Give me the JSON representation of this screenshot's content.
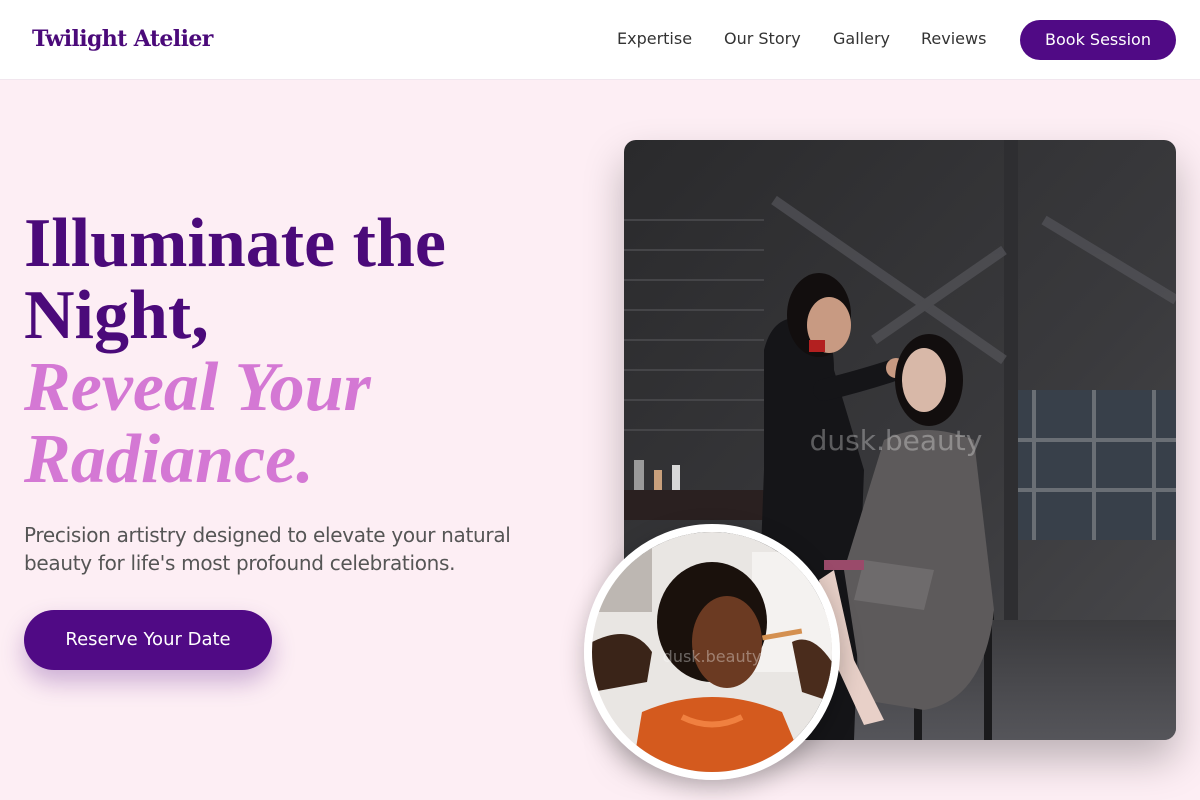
{
  "header": {
    "logo": "Twilight Atelier",
    "nav": {
      "expertise": "Expertise",
      "story": "Our Story",
      "gallery": "Gallery",
      "reviews": "Reviews"
    },
    "cta_label": "Book Session"
  },
  "hero": {
    "title_line1": "Illuminate the",
    "title_line2": "Night,",
    "accent_line1": "Reveal Your",
    "accent_line2": "Radiance.",
    "subtitle": "Precision artistry designed to elevate your natural beauty for life's most profound celebrations.",
    "cta_label": "Reserve Your Date"
  },
  "images": {
    "main_watermark": "dusk.beauty",
    "round_watermark": "dusk.beauty"
  },
  "colors": {
    "brand": "#500a85",
    "accent": "#d478d4",
    "page_bg": "#fdeef4"
  }
}
